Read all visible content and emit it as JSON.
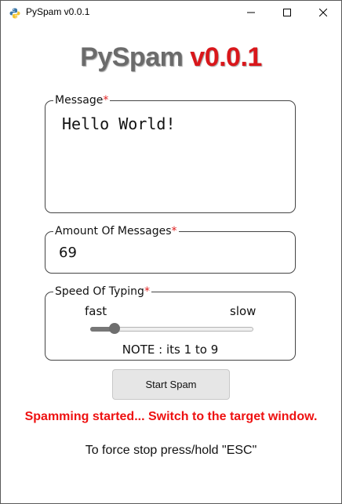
{
  "window": {
    "title": "PySpam v0.0.1",
    "icon": "python-icon",
    "controls": [
      "minimize-icon",
      "maximize-icon",
      "close-icon"
    ]
  },
  "header": {
    "name": "PySpam",
    "version": "v0.0.1",
    "name_color": "#6b6b6b",
    "version_color": "#d9171b"
  },
  "message": {
    "label": "Message",
    "required_mark": "*",
    "value": "Hello World!"
  },
  "amount": {
    "label": "Amount Of Messages",
    "required_mark": "*",
    "value": "69"
  },
  "speed": {
    "label": "Speed Of Typing",
    "required_mark": "*",
    "min_label": "fast",
    "max_label": "slow",
    "note": "NOTE : its 1 to 9",
    "range": [
      1,
      9
    ],
    "value": 2
  },
  "actions": {
    "start_label": "Start Spam"
  },
  "status": {
    "text": "Spamming started... Switch to the target window.",
    "color": "#ee1111"
  },
  "hint": {
    "text": "To force stop press/hold \"ESC\""
  }
}
